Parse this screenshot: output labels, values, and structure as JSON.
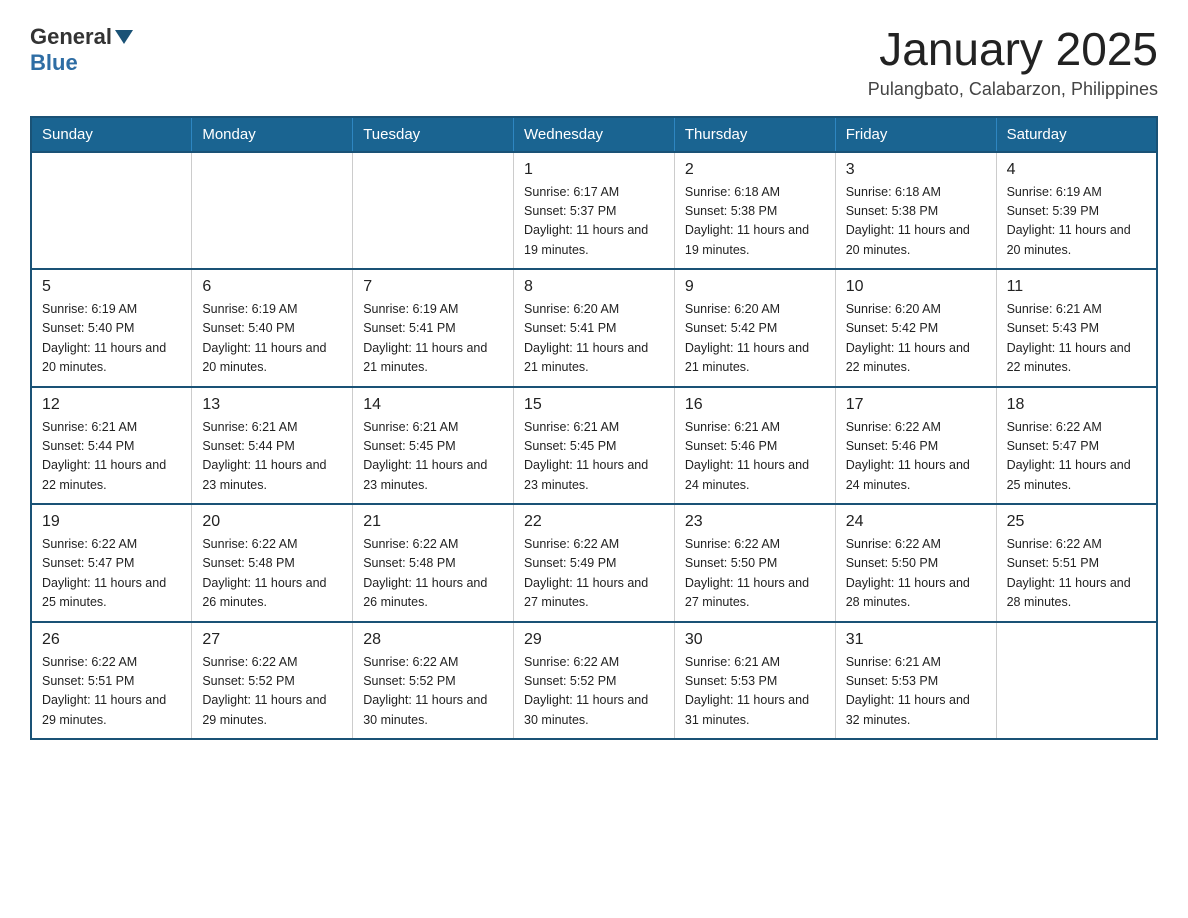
{
  "header": {
    "logo_general": "General",
    "logo_blue": "Blue",
    "month_title": "January 2025",
    "location": "Pulangbato, Calabarzon, Philippines"
  },
  "days_of_week": [
    "Sunday",
    "Monday",
    "Tuesday",
    "Wednesday",
    "Thursday",
    "Friday",
    "Saturday"
  ],
  "weeks": [
    [
      {
        "day": "",
        "info": ""
      },
      {
        "day": "",
        "info": ""
      },
      {
        "day": "",
        "info": ""
      },
      {
        "day": "1",
        "info": "Sunrise: 6:17 AM\nSunset: 5:37 PM\nDaylight: 11 hours\nand 19 minutes."
      },
      {
        "day": "2",
        "info": "Sunrise: 6:18 AM\nSunset: 5:38 PM\nDaylight: 11 hours\nand 19 minutes."
      },
      {
        "day": "3",
        "info": "Sunrise: 6:18 AM\nSunset: 5:38 PM\nDaylight: 11 hours\nand 20 minutes."
      },
      {
        "day": "4",
        "info": "Sunrise: 6:19 AM\nSunset: 5:39 PM\nDaylight: 11 hours\nand 20 minutes."
      }
    ],
    [
      {
        "day": "5",
        "info": "Sunrise: 6:19 AM\nSunset: 5:40 PM\nDaylight: 11 hours\nand 20 minutes."
      },
      {
        "day": "6",
        "info": "Sunrise: 6:19 AM\nSunset: 5:40 PM\nDaylight: 11 hours\nand 20 minutes."
      },
      {
        "day": "7",
        "info": "Sunrise: 6:19 AM\nSunset: 5:41 PM\nDaylight: 11 hours\nand 21 minutes."
      },
      {
        "day": "8",
        "info": "Sunrise: 6:20 AM\nSunset: 5:41 PM\nDaylight: 11 hours\nand 21 minutes."
      },
      {
        "day": "9",
        "info": "Sunrise: 6:20 AM\nSunset: 5:42 PM\nDaylight: 11 hours\nand 21 minutes."
      },
      {
        "day": "10",
        "info": "Sunrise: 6:20 AM\nSunset: 5:42 PM\nDaylight: 11 hours\nand 22 minutes."
      },
      {
        "day": "11",
        "info": "Sunrise: 6:21 AM\nSunset: 5:43 PM\nDaylight: 11 hours\nand 22 minutes."
      }
    ],
    [
      {
        "day": "12",
        "info": "Sunrise: 6:21 AM\nSunset: 5:44 PM\nDaylight: 11 hours\nand 22 minutes."
      },
      {
        "day": "13",
        "info": "Sunrise: 6:21 AM\nSunset: 5:44 PM\nDaylight: 11 hours\nand 23 minutes."
      },
      {
        "day": "14",
        "info": "Sunrise: 6:21 AM\nSunset: 5:45 PM\nDaylight: 11 hours\nand 23 minutes."
      },
      {
        "day": "15",
        "info": "Sunrise: 6:21 AM\nSunset: 5:45 PM\nDaylight: 11 hours\nand 23 minutes."
      },
      {
        "day": "16",
        "info": "Sunrise: 6:21 AM\nSunset: 5:46 PM\nDaylight: 11 hours\nand 24 minutes."
      },
      {
        "day": "17",
        "info": "Sunrise: 6:22 AM\nSunset: 5:46 PM\nDaylight: 11 hours\nand 24 minutes."
      },
      {
        "day": "18",
        "info": "Sunrise: 6:22 AM\nSunset: 5:47 PM\nDaylight: 11 hours\nand 25 minutes."
      }
    ],
    [
      {
        "day": "19",
        "info": "Sunrise: 6:22 AM\nSunset: 5:47 PM\nDaylight: 11 hours\nand 25 minutes."
      },
      {
        "day": "20",
        "info": "Sunrise: 6:22 AM\nSunset: 5:48 PM\nDaylight: 11 hours\nand 26 minutes."
      },
      {
        "day": "21",
        "info": "Sunrise: 6:22 AM\nSunset: 5:48 PM\nDaylight: 11 hours\nand 26 minutes."
      },
      {
        "day": "22",
        "info": "Sunrise: 6:22 AM\nSunset: 5:49 PM\nDaylight: 11 hours\nand 27 minutes."
      },
      {
        "day": "23",
        "info": "Sunrise: 6:22 AM\nSunset: 5:50 PM\nDaylight: 11 hours\nand 27 minutes."
      },
      {
        "day": "24",
        "info": "Sunrise: 6:22 AM\nSunset: 5:50 PM\nDaylight: 11 hours\nand 28 minutes."
      },
      {
        "day": "25",
        "info": "Sunrise: 6:22 AM\nSunset: 5:51 PM\nDaylight: 11 hours\nand 28 minutes."
      }
    ],
    [
      {
        "day": "26",
        "info": "Sunrise: 6:22 AM\nSunset: 5:51 PM\nDaylight: 11 hours\nand 29 minutes."
      },
      {
        "day": "27",
        "info": "Sunrise: 6:22 AM\nSunset: 5:52 PM\nDaylight: 11 hours\nand 29 minutes."
      },
      {
        "day": "28",
        "info": "Sunrise: 6:22 AM\nSunset: 5:52 PM\nDaylight: 11 hours\nand 30 minutes."
      },
      {
        "day": "29",
        "info": "Sunrise: 6:22 AM\nSunset: 5:52 PM\nDaylight: 11 hours\nand 30 minutes."
      },
      {
        "day": "30",
        "info": "Sunrise: 6:21 AM\nSunset: 5:53 PM\nDaylight: 11 hours\nand 31 minutes."
      },
      {
        "day": "31",
        "info": "Sunrise: 6:21 AM\nSunset: 5:53 PM\nDaylight: 11 hours\nand 32 minutes."
      },
      {
        "day": "",
        "info": ""
      }
    ]
  ]
}
